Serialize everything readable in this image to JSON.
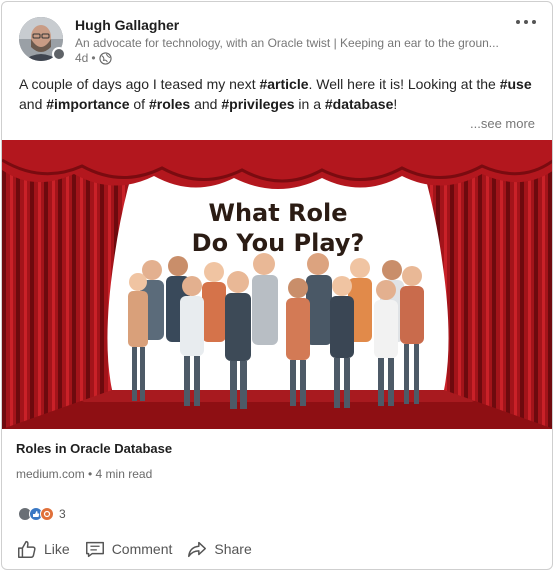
{
  "author": {
    "name": "Hugh Gallagher",
    "headline": "An advocate for technology, with an Oracle twist | Keeping an ear to the groun...",
    "age": "4d",
    "separator": "•"
  },
  "post": {
    "text_parts": [
      {
        "t": "A couple of days ago I teased my next ",
        "tag": false
      },
      {
        "t": "#article",
        "tag": true
      },
      {
        "t": ". Well here it is! Looking at the ",
        "tag": false
      },
      {
        "t": "#use",
        "tag": true
      },
      {
        "t": " and ",
        "tag": false
      },
      {
        "t": "#importance",
        "tag": true
      },
      {
        "t": " of ",
        "tag": false
      },
      {
        "t": "#roles",
        "tag": true
      },
      {
        "t": " and ",
        "tag": false
      },
      {
        "t": "#privileges",
        "tag": true
      },
      {
        "t": " in a ",
        "tag": false
      },
      {
        "t": "#database",
        "tag": true
      },
      {
        "t": "!",
        "tag": false
      }
    ],
    "see_more": "...see more"
  },
  "image": {
    "title_line1": "What Role",
    "title_line2": "Do You Play?"
  },
  "link_preview": {
    "title": "Roles in Oracle Database",
    "meta": "medium.com • 4 min read"
  },
  "reactions": {
    "count": "3",
    "types": [
      "avatar-reaction",
      "like-icon",
      "support-icon"
    ]
  },
  "actions": {
    "like": "Like",
    "comment": "Comment",
    "share": "Share"
  },
  "colors": {
    "curtain": "#a3141a",
    "curtain_dark": "#6e0a0e",
    "stage": "#8e0f13",
    "like_blue": "#3a78c4",
    "support_orange": "#e0703a"
  }
}
